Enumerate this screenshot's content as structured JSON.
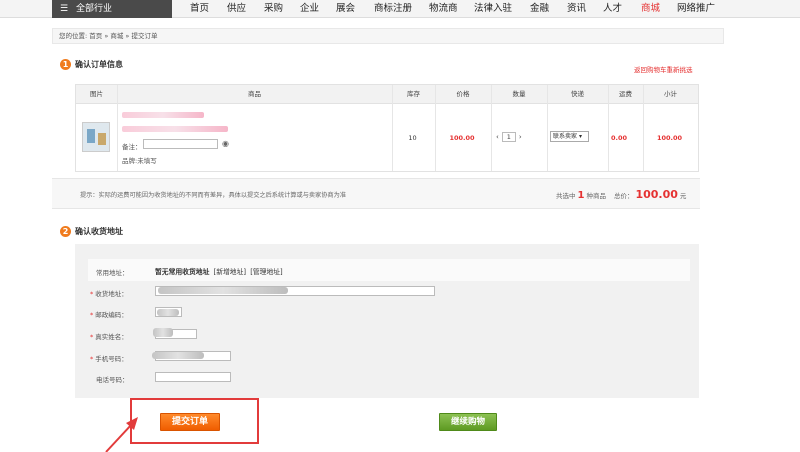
{
  "nav": {
    "category_label": "全部行业",
    "items": [
      "首页",
      "供应",
      "采购",
      "企业",
      "展会",
      "商标注册",
      "物流商",
      "法律入驻",
      "金融",
      "资讯",
      "人才",
      "商城",
      "网络推广"
    ],
    "active": "商城"
  },
  "breadcrumb": "您的位置: 首页 » 商城 » 提交订单",
  "step1": {
    "number": "1",
    "title": "确认订单信息",
    "back_link": "返回购物车重新挑选"
  },
  "table": {
    "headers": [
      "图片",
      "商品",
      "库存",
      "价格",
      "数量",
      "快递",
      "运费",
      "小计"
    ],
    "row": {
      "remark_label": "备注：",
      "brand": "品牌:未填写",
      "stock": "10",
      "price": "100.00",
      "qty": "1",
      "qty_minus": "‹",
      "qty_plus": "›",
      "shipping": "联系卖家",
      "freight": "0.00",
      "subtotal": "100.00"
    }
  },
  "summary": {
    "tip": "提示：实际的运费可能因为收货地址的不同而有差异，具体以提交之后系统计算或与卖家协商为准",
    "count_prefix": "共选中",
    "count": "1",
    "count_suffix": "种商品",
    "total_label": "总价：",
    "total": "100.00",
    "currency": "元"
  },
  "step2": {
    "number": "2",
    "title": "确认收货地址"
  },
  "address": {
    "common_label": "常用地址：",
    "common_none": "暂无常用收货地址",
    "new_link": "[新增地址]",
    "manage_link": "[管理地址]",
    "fields": [
      {
        "required": true,
        "label": "收货地址："
      },
      {
        "required": true,
        "label": "邮政编码："
      },
      {
        "required": true,
        "label": "真实姓名："
      },
      {
        "required": true,
        "label": "手机号码："
      },
      {
        "required": false,
        "label": "电话号码："
      }
    ]
  },
  "buttons": {
    "submit": "提交订单",
    "continue": "继续购物"
  },
  "colors": {
    "accent_red": "#e53131",
    "orange": "#f05d00",
    "green": "#5e9a22"
  }
}
